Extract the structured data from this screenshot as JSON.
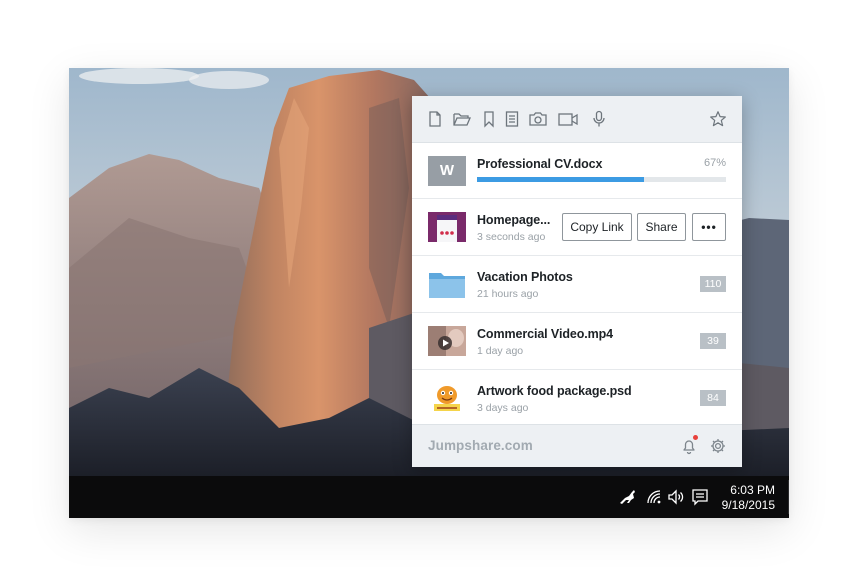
{
  "toolbar": {
    "icons": [
      "new-file-icon",
      "open-folder-icon",
      "bookmark-icon",
      "notes-icon",
      "camera-icon",
      "video-camera-icon",
      "microphone-icon",
      "star-icon"
    ]
  },
  "uploads": [
    {
      "name": "Professional CV.docx",
      "thumb_letter": "W",
      "progress": 0.67,
      "progress_text": "67%"
    },
    {
      "name": "Homepage...",
      "time": "3 seconds ago",
      "actions": [
        "Copy Link",
        "Share",
        "•••"
      ]
    },
    {
      "name": "Vacation Photos",
      "time": "21 hours ago",
      "count": "110",
      "icon": "folder-icon"
    },
    {
      "name": "Commercial Video.mp4",
      "time": "1 day ago",
      "count": "39"
    },
    {
      "name": "Artwork food package.psd",
      "time": "3 days ago",
      "count": "84"
    }
  ],
  "footer": {
    "brand": "Jumpshare.com",
    "icons": [
      "bell-icon",
      "gear-icon"
    ],
    "notification": true
  },
  "taskbar": {
    "time": "6:03 PM",
    "date": "9/18/2015",
    "tray_icons": [
      "kangaroo-icon",
      "wifi-icon",
      "volume-icon",
      "action-center-icon"
    ]
  },
  "colors": {
    "accent": "#3c9be3",
    "panel_header": "#edf0f3",
    "badge": "#b9c0c6",
    "notification_dot": "#e8413c"
  }
}
